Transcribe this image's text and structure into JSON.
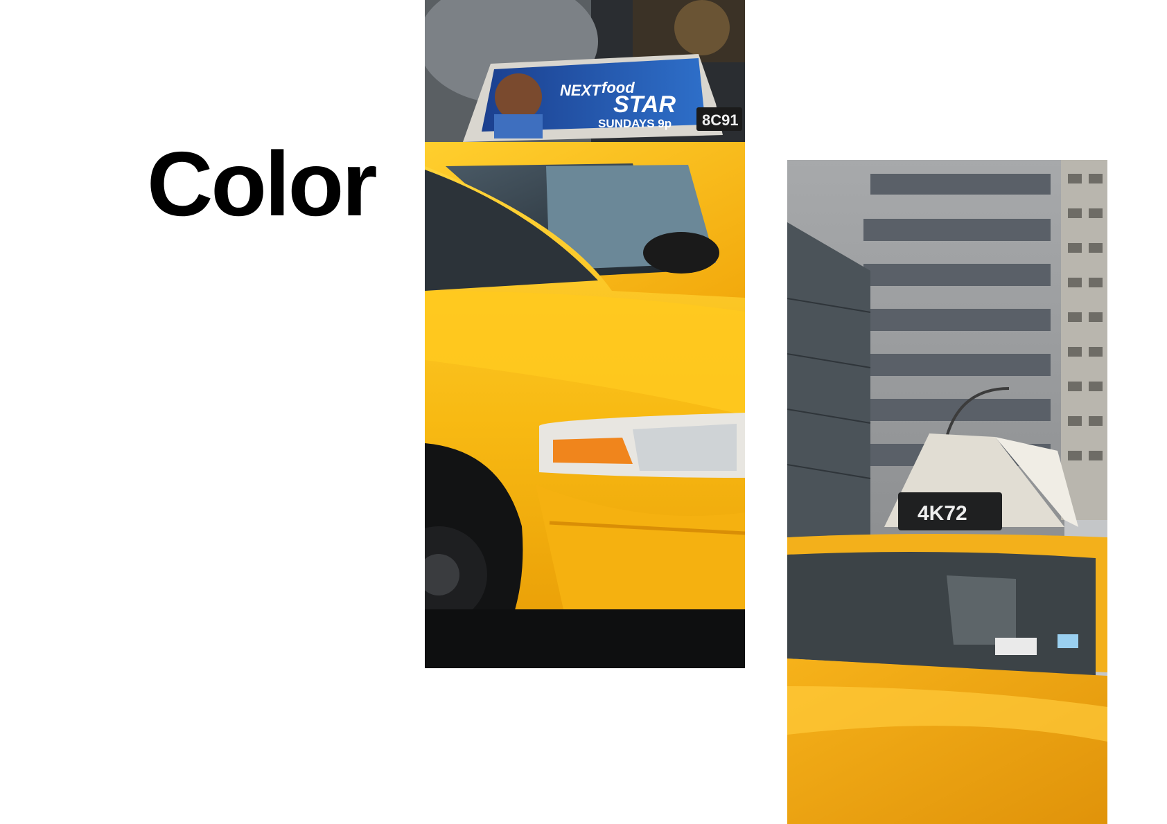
{
  "slide": {
    "title": "Color"
  },
  "left_photo": {
    "ad": {
      "brand_line1": "NEXT",
      "brand_food": "food",
      "brand_line2": "STAR",
      "schedule": "SUNDAYS 9p"
    },
    "medallion": "8C91"
  },
  "right_photo": {
    "medallion": "4K72"
  },
  "colors": {
    "taxi_yellow": "#F6B21A",
    "taxi_yellow_light": "#FFD24A",
    "ad_blue": "#1E4FA8",
    "background": "#FFFFFF",
    "text": "#000000"
  }
}
